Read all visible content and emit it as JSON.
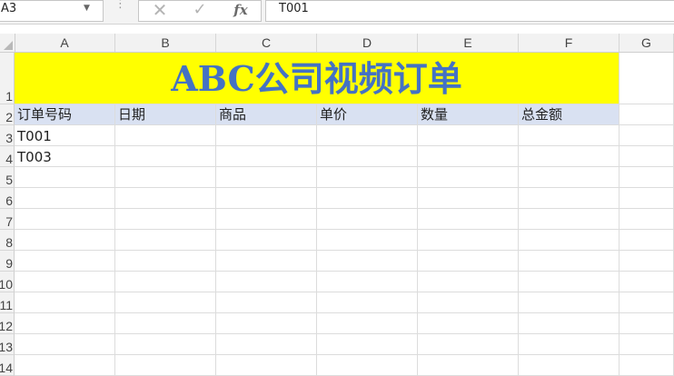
{
  "formula_bar": {
    "name_box": "A3",
    "cancel_icon": "✕",
    "enter_icon": "✓",
    "fx_label": "fx",
    "content": "T001"
  },
  "column_headers": [
    "A",
    "B",
    "C",
    "D",
    "E",
    "F",
    "G"
  ],
  "row_headers": [
    "1",
    "2",
    "3",
    "4",
    "5",
    "6",
    "7",
    "8",
    "9",
    "10",
    "11",
    "12",
    "13",
    "14"
  ],
  "sheet": {
    "title": "ABC公司视频订单",
    "headers": [
      "订单号码",
      "日期",
      "商品",
      "单价",
      "数量",
      "总金额"
    ],
    "rows": [
      [
        "T001",
        "",
        "",
        "",
        "",
        ""
      ],
      [
        "T003",
        "",
        "",
        "",
        "",
        ""
      ]
    ]
  },
  "colors": {
    "title_fill": "#ffff00",
    "title_text": "#4472c4",
    "header_fill": "#d9e1f2"
  }
}
